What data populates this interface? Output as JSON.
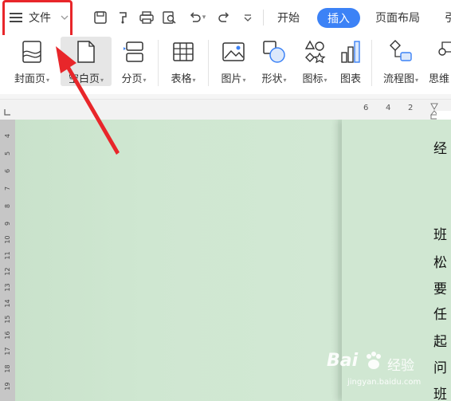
{
  "file_menu": {
    "label": "文件"
  },
  "tabs": [
    {
      "label": "开始"
    },
    {
      "label": "插入"
    },
    {
      "label": "页面布局"
    }
  ],
  "ribbon": {
    "items": [
      {
        "label": "封面页",
        "icon": "cover-page-icon"
      },
      {
        "label": "空白页",
        "icon": "blank-page-icon"
      },
      {
        "label": "分页",
        "icon": "page-break-icon"
      },
      {
        "label": "表格",
        "icon": "table-icon"
      },
      {
        "label": "图片",
        "icon": "picture-icon"
      },
      {
        "label": "形状",
        "icon": "shapes-icon"
      },
      {
        "label": "图标",
        "icon": "icons-icon"
      },
      {
        "label": "图表",
        "icon": "chart-icon"
      },
      {
        "label": "流程图",
        "icon": "flowchart-icon"
      },
      {
        "label": "思维",
        "icon": "mindmap-icon"
      }
    ]
  },
  "ruler": {
    "horizontal": [
      "6",
      "4",
      "2"
    ],
    "vertical": [
      "4",
      "5",
      "6",
      "7",
      "8",
      "9",
      "10",
      "11",
      "12",
      "13",
      "14",
      "15",
      "16",
      "17",
      "18",
      "19"
    ]
  },
  "document": {
    "lines": [
      "经",
      "班",
      "松",
      "要",
      "任",
      "起",
      "问",
      "班"
    ]
  },
  "watermark": {
    "brand": "Bai",
    "suffix": "经验",
    "url": "jingyan.baidu.com"
  },
  "colors": {
    "accent": "#3c82f6",
    "highlight_box": "#e8262a",
    "workspace_bg": "#cce5cf"
  }
}
